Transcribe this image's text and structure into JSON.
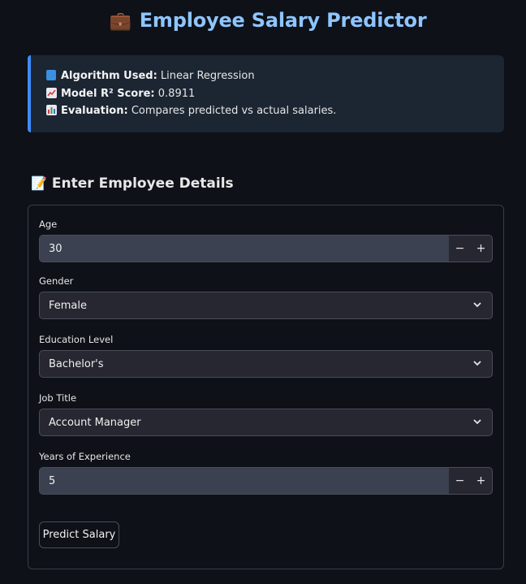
{
  "header": {
    "title_emoji": "💼",
    "title": "Employee Salary Predictor"
  },
  "info": {
    "algorithm": {
      "icon": "blue-book-icon",
      "label": "Algorithm Used:",
      "value": "Linear Regression"
    },
    "score": {
      "icon": "chart-increasing-icon",
      "label": "Model R² Score:",
      "value": "0.8911"
    },
    "evaluation": {
      "icon": "bar-chart-icon",
      "label": "Evaluation:",
      "value": "Compares predicted vs actual salaries."
    }
  },
  "form": {
    "section_emoji": "📝",
    "section_title": "Enter Employee Details",
    "age": {
      "label": "Age",
      "value": "30"
    },
    "gender": {
      "label": "Gender",
      "value": "Female"
    },
    "education": {
      "label": "Education Level",
      "value": "Bachelor's"
    },
    "job_title": {
      "label": "Job Title",
      "value": "Account Manager"
    },
    "experience": {
      "label": "Years of Experience",
      "value": "5"
    },
    "stepper_minus": "−",
    "stepper_plus": "+",
    "submit_label": "Predict Salary"
  },
  "colors": {
    "background": "#0e1117",
    "title": "#8ec5ff",
    "info_background": "#1c2532",
    "info_accent": "#3d8bfd"
  }
}
